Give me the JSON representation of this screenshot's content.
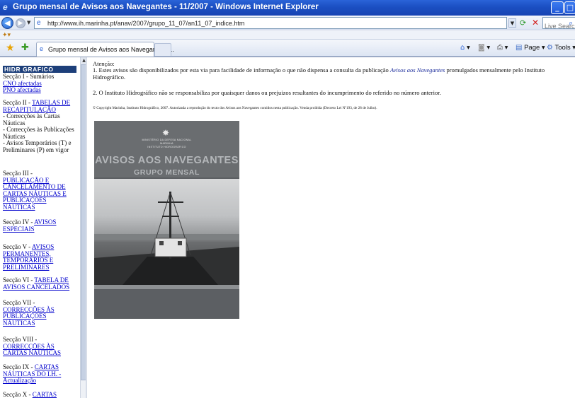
{
  "window": {
    "title": "Grupo mensal de Avisos aos Navegantes - 11/2007 - Windows Internet Explorer",
    "minimize_glyph": "_",
    "maximize_glyph": "□"
  },
  "address_bar": {
    "url": "http://www.ih.marinha.pt/anav/2007/grupo_11_07/an11_07_indice.htm",
    "search_placeholder": "Live Search"
  },
  "tab": {
    "label": "Grupo mensal de Avisos aos Navegantes -..."
  },
  "command_bar": {
    "page_label": "Page",
    "tools_label": "Tools"
  },
  "icons": {
    "back": "back-arrow-icon",
    "forward": "forward-arrow-icon",
    "refresh": "refresh-icon",
    "stop": "stop-icon",
    "search": "search-icon",
    "favorites": "favorites-star-icon",
    "add_favorites": "add-favorites-icon",
    "home": "home-icon",
    "feeds": "feeds-icon",
    "print": "print-icon"
  },
  "sidebar": {
    "logo_text": "HIDR  GRAFICO",
    "sections": [
      {
        "prefix": "Secção I - Sumários",
        "links": [
          "CNO afectadas",
          "PNO afectadas"
        ]
      },
      {
        "prefix": "Secção II - ",
        "links": [
          "TABELAS DE RECAPITULAÇÃO"
        ],
        "extra": [
          "- Correcções às Cartas Náuticas",
          "- Correcções às Publicações Náuticas",
          "- Avisos Temporários (T) e Preliminares (P) em vigor"
        ]
      },
      {
        "prefix": "Secção III - ",
        "links": [
          "PUBLICAÇÃO E CANCELAMENTO DE CARTAS NÁUTICAS  E PUBLICAÇÕES NÁUTICAS"
        ]
      },
      {
        "prefix": "Secção IV - ",
        "links": [
          "AVISOS ESPECIAIS"
        ]
      },
      {
        "prefix": "Secção V - ",
        "links": [
          "AVISOS PERMANENTES, TEMPORÁRIOS E PRELIMINARES"
        ]
      },
      {
        "prefix": "Secção VI - ",
        "links": [
          "TABELA DE AVISOS CANCELADOS"
        ]
      },
      {
        "prefix": "Secção VII - ",
        "links": [
          "CORRECÇÕES ÀS PUBLICAÇÕES NÁUTICAS"
        ]
      },
      {
        "prefix": " Secção VIII - ",
        "links": [
          "CORRECÇÕES ÀS CARTAS NÁUTICAS"
        ]
      },
      {
        "prefix": "Secção IX - ",
        "links": [
          "CARTAS NÁUTICAS  DO I.H. - Actualização"
        ]
      },
      {
        "prefix": "Secção X - ",
        "links": [
          "CARTAS"
        ]
      }
    ]
  },
  "main": {
    "attention": "Atenção:",
    "para1_before": "1.  Estes avisos são disponibilizados por esta via para facilidade de informação o que não dispensa a consulta da publicação ",
    "para1_publication": "Avisos aos Navegantes",
    "para1_after": " promulgados mensalmente pelo Instituto Hidrográfico.",
    "para2": "2.  O Instituto Hidrográfico não se responsabiliza por quaisquer danos ou prejuizos resultantes do incumprimento do referido no número anterior.",
    "copyright": "© Copyright Marinha, Instituto Hidrográfico, 2007. Autorizada a reprodução do texto dos Avisos aos Navegantes contidos nesta publicação. Venda proibida (Decreto Lei Nº193, de 28 de Julho).",
    "cover": {
      "line1": "MINISTÉRIO DA DEFESA NACIONAL",
      "line2": "MARINHA",
      "line3": "INSTITUTO HIDROGRÁFICO",
      "title": "AVISOS AOS NAVEGANTES",
      "subtitle": "GRUPO MENSAL"
    }
  }
}
